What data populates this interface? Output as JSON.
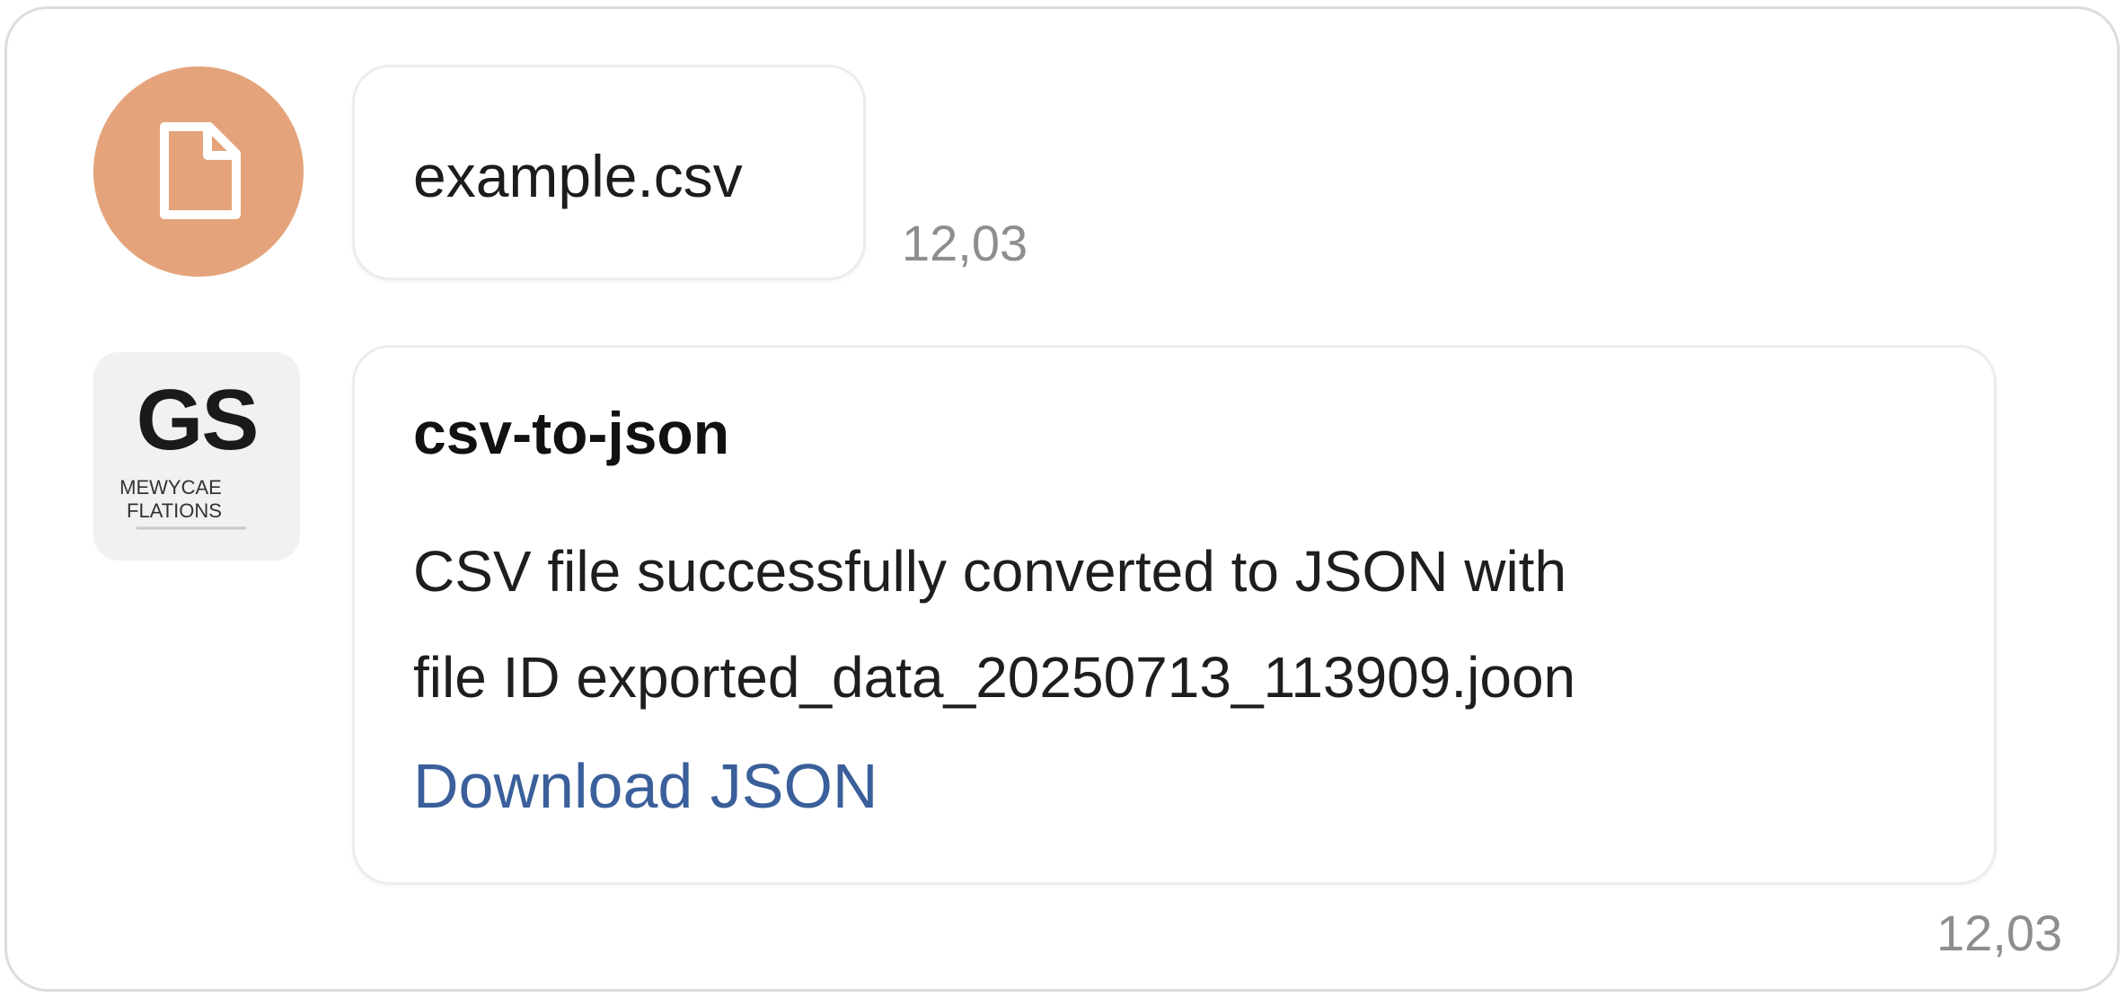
{
  "messages": [
    {
      "type": "file",
      "avatar_icon": "document-icon",
      "avatar_color": "#e4a37a",
      "filename": "example.csv",
      "time": "12,03"
    },
    {
      "type": "bot",
      "avatar_logo": {
        "mark": "GS",
        "line1": "MEWYCAE",
        "line2": "FLATIONS"
      },
      "sender": "csv-to-json",
      "text_line1": "CSV file successfully converted to JSON with",
      "text_line2": "file ID exported_data_20250713_113909.joon",
      "link_label": "Download JSON",
      "link_color": "#3a5f9a",
      "time": "12,03"
    }
  ]
}
